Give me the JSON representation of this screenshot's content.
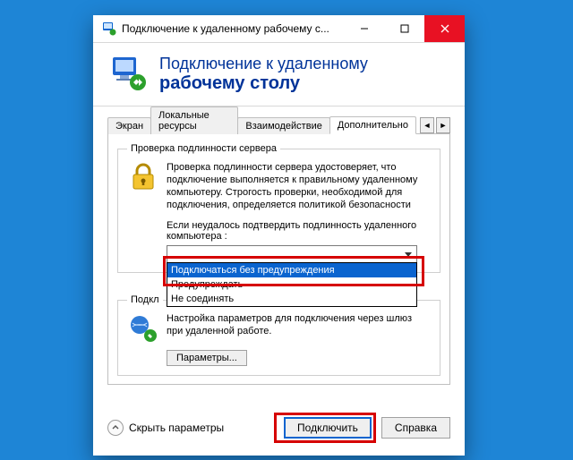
{
  "window": {
    "title": "Подключение к удаленному рабочему с..."
  },
  "header": {
    "line1": "Подключение к удаленному",
    "line2": "рабочему столу"
  },
  "tabs": {
    "items": [
      {
        "label": "Экран"
      },
      {
        "label": "Локальные ресурсы"
      },
      {
        "label": "Взаимодействие"
      },
      {
        "label": "Дополнительно"
      }
    ]
  },
  "group1": {
    "legend": "Проверка подлинности сервера",
    "text": "Проверка подлинности сервера удостоверяет, что подключение выполняется к правильному удаленному компьютеру. Строгость проверки, необходимой для подключения, определяется политикой безопасности",
    "sub": "Если неудалось подтвердить подлинность удаленного компьютера :",
    "selected": "Предупреждать",
    "options": [
      "Подключаться без предупреждения",
      "Предупреждать",
      "Не соединять"
    ]
  },
  "group2": {
    "legend": "Подкл",
    "text": "Настройка параметров для подключения через шлюз при удаленной работе.",
    "button": "Параметры..."
  },
  "footer": {
    "expand": "Скрыть параметры",
    "connect": "Подключить",
    "help": "Справка"
  }
}
